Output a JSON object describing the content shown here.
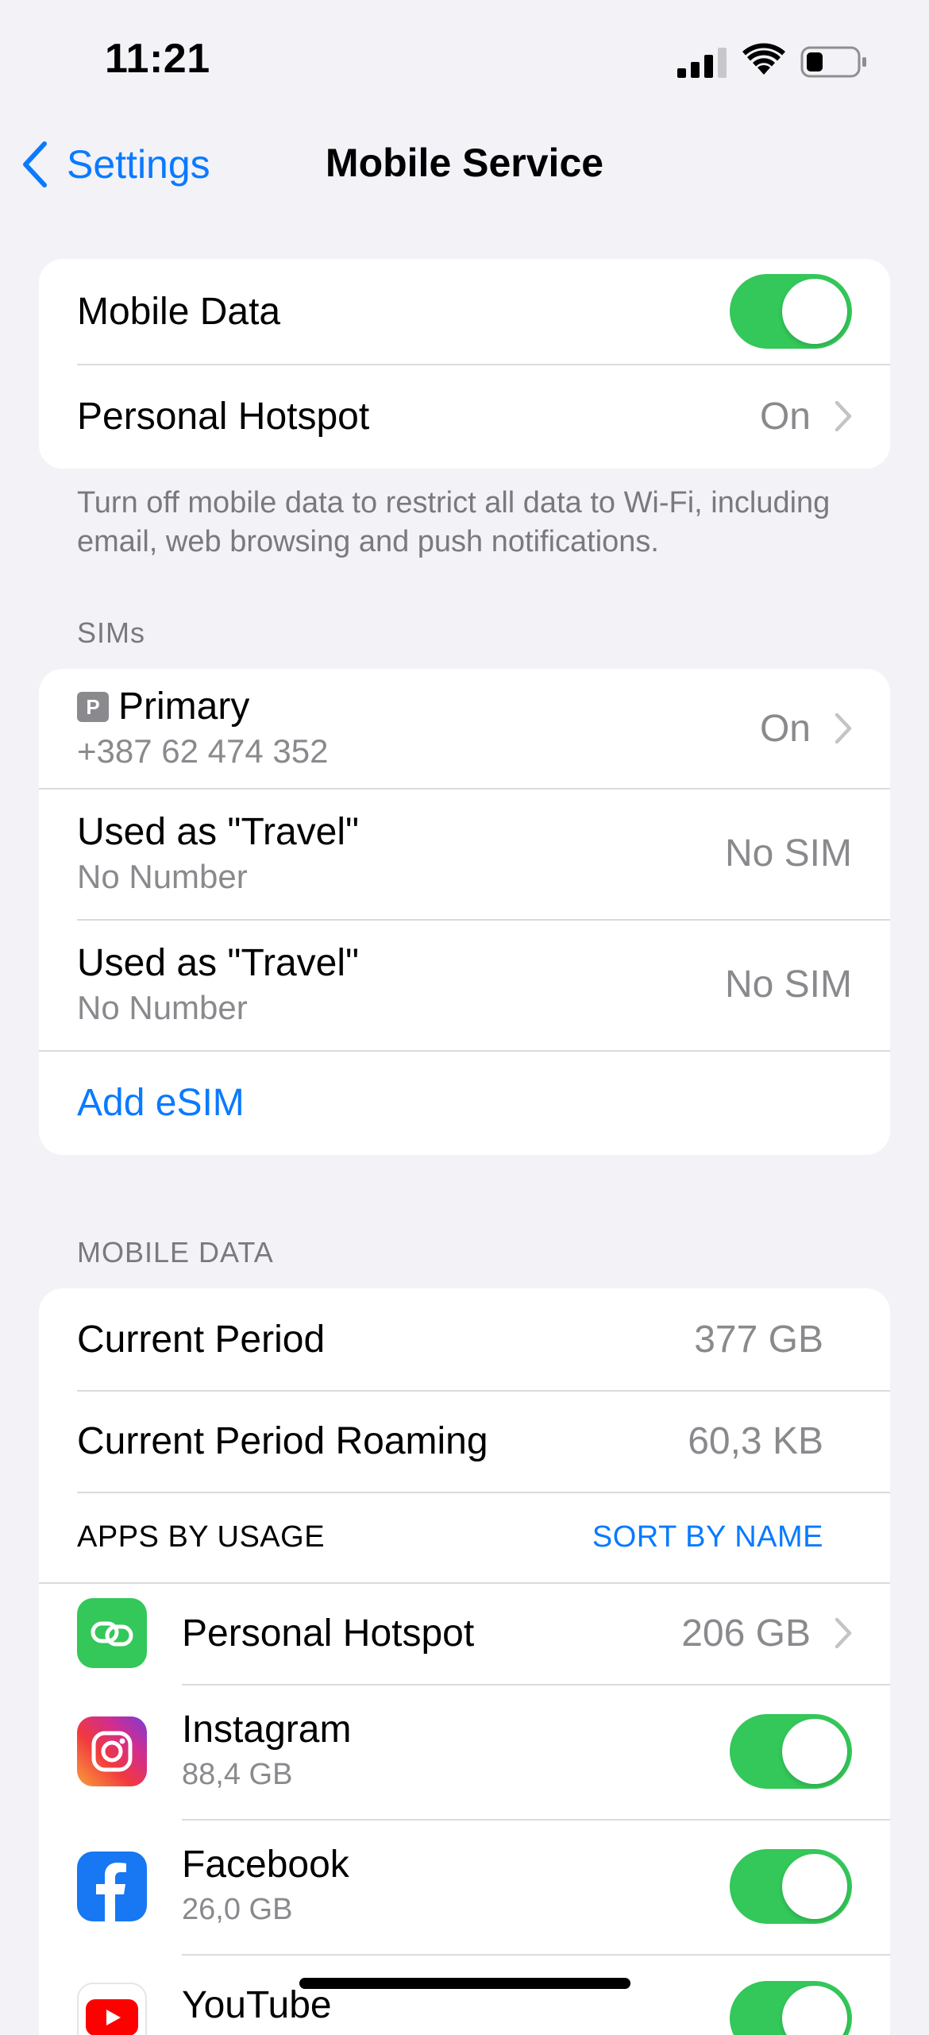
{
  "status_bar": {
    "time": "11:21"
  },
  "nav": {
    "back_label": "Settings",
    "title": "Mobile Service"
  },
  "top_group": {
    "mobile_data_label": "Mobile Data",
    "mobile_data_on": true,
    "hotspot_label": "Personal Hotspot",
    "hotspot_value": "On"
  },
  "top_footer": "Turn off mobile data to restrict all data to Wi-Fi, including email, web browsing and push notifications.",
  "sims": {
    "header": "SIMs",
    "items": [
      {
        "badge": "P",
        "title": "Primary",
        "sub": "+387 62 474 352",
        "value": "On"
      },
      {
        "title": "Used as \"Travel\"",
        "sub": "No Number",
        "value": "No SIM"
      },
      {
        "title": "Used as \"Travel\"",
        "sub": "No Number",
        "value": "No SIM"
      }
    ],
    "add_esim": "Add eSIM"
  },
  "mobile_data": {
    "header": "MOBILE DATA",
    "current_period_label": "Current Period",
    "current_period_value": "377 GB",
    "roaming_label": "Current Period Roaming",
    "roaming_value": "60,3 KB",
    "apps_by_usage": "APPS BY USAGE",
    "sort_by_name": "SORT BY NAME",
    "apps": [
      {
        "name": "Personal Hotspot",
        "value": "206 GB",
        "icon": "personal-hotspot-icon"
      },
      {
        "name": "Instagram",
        "usage": "88,4 GB",
        "icon": "instagram-icon",
        "enabled": true
      },
      {
        "name": "Facebook",
        "usage": "26,0 GB",
        "icon": "facebook-icon",
        "enabled": true
      },
      {
        "name": "YouTube",
        "icon": "youtube-icon",
        "enabled": true
      }
    ]
  },
  "colors": {
    "accent": "#0a7aff",
    "toggle_on": "#34c759",
    "background": "#f2f2f7"
  }
}
